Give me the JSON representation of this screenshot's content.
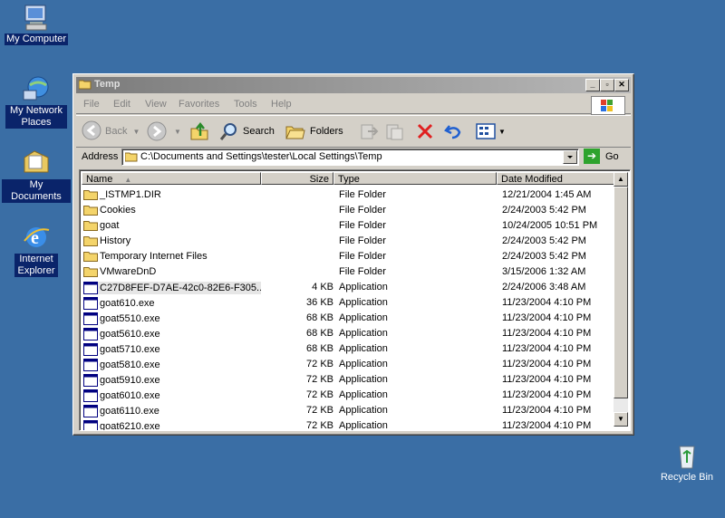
{
  "desktop": {
    "icons": [
      {
        "label": "My Computer"
      },
      {
        "label": "My Network Places"
      },
      {
        "label": "My Documents"
      },
      {
        "label": "Internet Explorer"
      },
      {
        "label": "Recycle Bin"
      }
    ]
  },
  "window": {
    "title": "Temp",
    "menu": [
      "File",
      "Edit",
      "View",
      "Favorites",
      "Tools",
      "Help"
    ],
    "toolbar": {
      "back": "Back",
      "search": "Search",
      "folders": "Folders"
    },
    "address": {
      "label": "Address",
      "value": "C:\\Documents and Settings\\tester\\Local Settings\\Temp",
      "go": "Go"
    },
    "columns": {
      "name": "Name",
      "size": "Size",
      "type": "Type",
      "date": "Date Modified"
    },
    "files": [
      {
        "name": "_ISTMP1.DIR",
        "size": "",
        "type": "File Folder",
        "date": "12/21/2004 1:45 AM",
        "icon": "folder"
      },
      {
        "name": "Cookies",
        "size": "",
        "type": "File Folder",
        "date": "2/24/2003 5:42 PM",
        "icon": "folder"
      },
      {
        "name": "goat",
        "size": "",
        "type": "File Folder",
        "date": "10/24/2005 10:51 PM",
        "icon": "folder"
      },
      {
        "name": "History",
        "size": "",
        "type": "File Folder",
        "date": "2/24/2003 5:42 PM",
        "icon": "folder"
      },
      {
        "name": "Temporary Internet Files",
        "size": "",
        "type": "File Folder",
        "date": "2/24/2003 5:42 PM",
        "icon": "folder"
      },
      {
        "name": "VMwareDnD",
        "size": "",
        "type": "File Folder",
        "date": "3/15/2006 1:32 AM",
        "icon": "folder"
      },
      {
        "name": "C27D8FEF-D7AE-42c0-82E6-F305...",
        "size": "4 KB",
        "type": "Application",
        "date": "2/24/2006 3:48 AM",
        "icon": "app"
      },
      {
        "name": "goat610.exe",
        "size": "36 KB",
        "type": "Application",
        "date": "11/23/2004 4:10 PM",
        "icon": "app"
      },
      {
        "name": "goat5510.exe",
        "size": "68 KB",
        "type": "Application",
        "date": "11/23/2004 4:10 PM",
        "icon": "app"
      },
      {
        "name": "goat5610.exe",
        "size": "68 KB",
        "type": "Application",
        "date": "11/23/2004 4:10 PM",
        "icon": "app"
      },
      {
        "name": "goat5710.exe",
        "size": "68 KB",
        "type": "Application",
        "date": "11/23/2004 4:10 PM",
        "icon": "app"
      },
      {
        "name": "goat5810.exe",
        "size": "72 KB",
        "type": "Application",
        "date": "11/23/2004 4:10 PM",
        "icon": "app"
      },
      {
        "name": "goat5910.exe",
        "size": "72 KB",
        "type": "Application",
        "date": "11/23/2004 4:10 PM",
        "icon": "app"
      },
      {
        "name": "goat6010.exe",
        "size": "72 KB",
        "type": "Application",
        "date": "11/23/2004 4:10 PM",
        "icon": "app"
      },
      {
        "name": "goat6110.exe",
        "size": "72 KB",
        "type": "Application",
        "date": "11/23/2004 4:10 PM",
        "icon": "app"
      },
      {
        "name": "goat6210.exe",
        "size": "72 KB",
        "type": "Application",
        "date": "11/23/2004 4:10 PM",
        "icon": "app"
      }
    ]
  },
  "colors": {
    "desktop": "#3a6ea5",
    "selection": "#0a246a",
    "folder": "#f4d46a"
  }
}
